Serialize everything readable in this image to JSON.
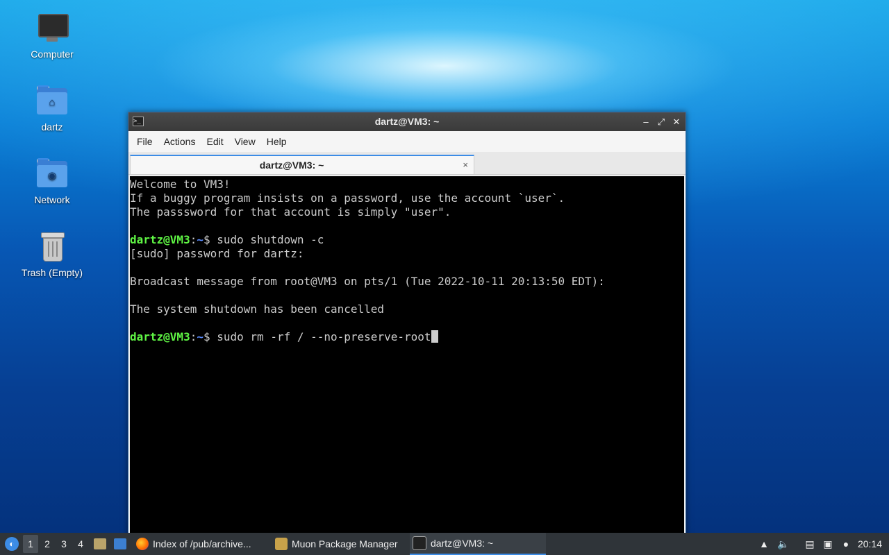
{
  "desktop": {
    "icons": [
      {
        "label": "Computer"
      },
      {
        "label": "dartz"
      },
      {
        "label": "Network"
      },
      {
        "label": "Trash (Empty)"
      }
    ]
  },
  "window": {
    "title": "dartz@VM3: ~",
    "menu": [
      "File",
      "Actions",
      "Edit",
      "View",
      "Help"
    ],
    "tab": {
      "label": "dartz@VM3: ~",
      "close": "×"
    },
    "controls": {
      "minimize": "–",
      "maximize": "⤢",
      "close": "✕"
    }
  },
  "terminal": {
    "lines": [
      "Welcome to VM3!",
      "If a buggy program insists on a password, use the account `user`.",
      "The passsword for that account is simply \"user\".",
      "",
      "[sudo] password for dartz:",
      "",
      "Broadcast message from root@VM3 on pts/1 (Tue 2022-10-11 20:13:50 EDT):",
      "",
      "The system shutdown has been cancelled",
      ""
    ],
    "prompt_user": "dartz@VM3",
    "prompt_sep": ":",
    "prompt_path": "~",
    "prompt_dollar": "$ ",
    "cmd1": "sudo shutdown -c",
    "cmd2": "sudo rm -rf / --no-preserve-root"
  },
  "taskbar": {
    "workspaces": [
      "1",
      "2",
      "3",
      "4"
    ],
    "tasks": [
      {
        "label": "Index of /pub/archive..."
      },
      {
        "label": "Muon Package Manager"
      },
      {
        "label": "dartz@VM3: ~"
      }
    ],
    "clock": "20:14",
    "colors": {
      "accent": "#3c8ce6",
      "prompt_user": "#5ff544",
      "prompt_path": "#5a8cff"
    }
  }
}
